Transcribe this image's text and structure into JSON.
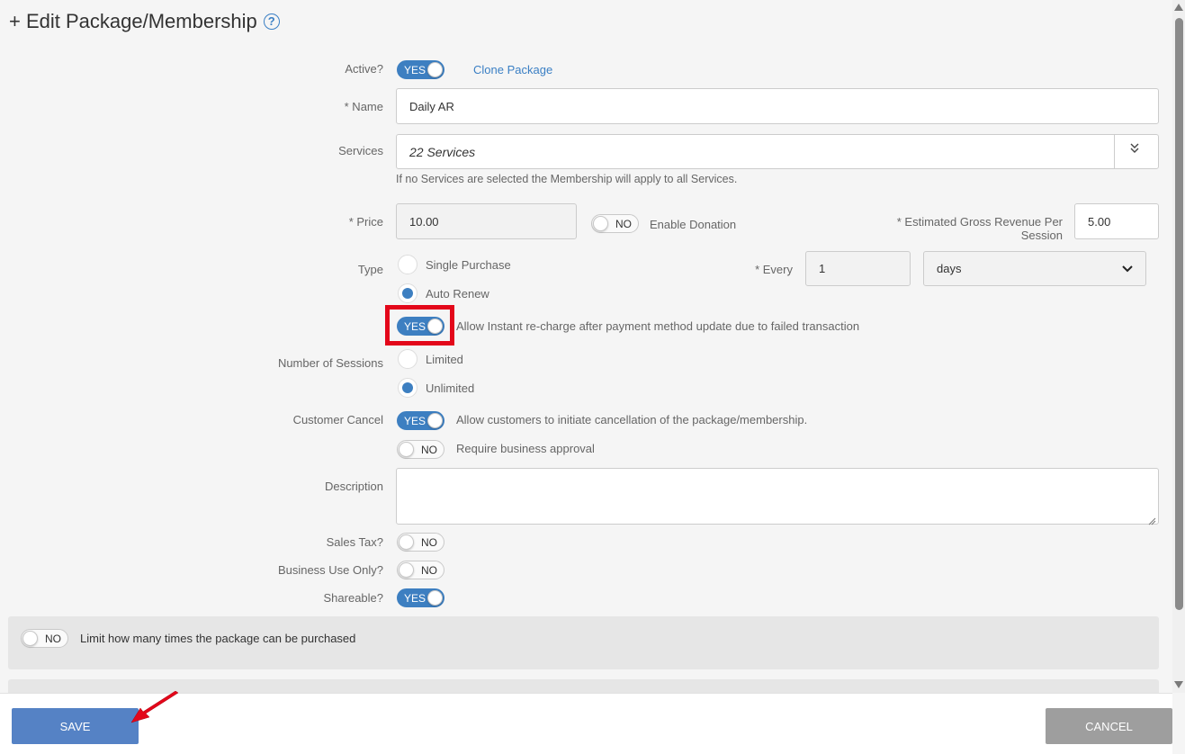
{
  "header": {
    "title": "+ Edit Package/Membership",
    "help_icon": "?"
  },
  "form": {
    "active_label": "Active?",
    "active_toggle": "YES",
    "clone_link": "Clone Package",
    "name_label": "* Name",
    "name_value": "Daily AR",
    "services_label": "Services",
    "services_value": "22 Services",
    "services_hint": "If no Services are selected the Membership will apply to all Services.",
    "price_label": "* Price",
    "price_value": "10.00",
    "donation_toggle": "NO",
    "donation_label": "Enable Donation",
    "revenue_label_line1": "* Estimated Gross Revenue Per",
    "revenue_label_line2": "Session",
    "revenue_value": "5.00",
    "type_label": "Type",
    "type_options": [
      "Single Purchase",
      "Auto Renew"
    ],
    "type_selected": "Auto Renew",
    "every_label": "* Every",
    "every_value": "1",
    "every_unit": "days",
    "recharge_toggle": "YES",
    "recharge_label": "Allow Instant re-charge after payment method update due to failed transaction",
    "sessions_label": "Number of Sessions",
    "sessions_options": [
      "Limited",
      "Unlimited"
    ],
    "sessions_selected": "Unlimited",
    "customer_cancel_label": "Customer Cancel",
    "customer_cancel_toggle": "YES",
    "customer_cancel_text": "Allow customers to initiate cancellation of the package/membership.",
    "approval_toggle": "NO",
    "approval_text": "Require business approval",
    "description_label": "Description",
    "description_value": "",
    "sales_tax_label": "Sales Tax?",
    "sales_tax_toggle": "NO",
    "business_use_label": "Business Use Only?",
    "business_use_toggle": "NO",
    "shareable_label": "Shareable?",
    "shareable_toggle": "YES"
  },
  "panels": {
    "limit_toggle": "NO",
    "limit_text": "Limit how many times the package can be purchased"
  },
  "footer": {
    "save_label": "SAVE",
    "cancel_label": "CANCEL"
  },
  "colors": {
    "accent": "#3d7fc1",
    "highlight": "#e3071a",
    "annotation_arrow": "#e3071a"
  }
}
